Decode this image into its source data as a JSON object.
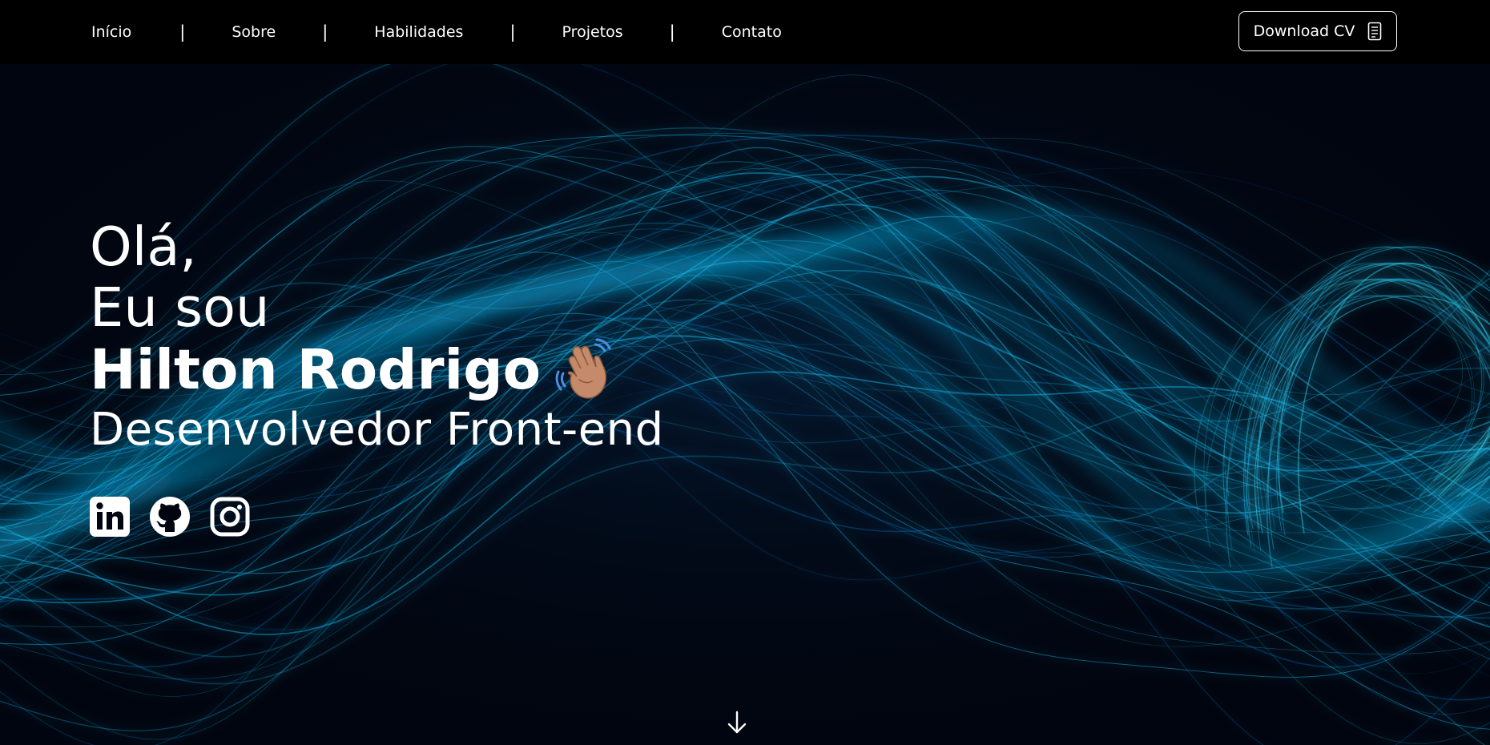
{
  "nav": {
    "items": [
      {
        "label": "Início"
      },
      {
        "label": "Sobre"
      },
      {
        "label": "Habilidades"
      },
      {
        "label": "Projetos"
      },
      {
        "label": "Contato"
      }
    ],
    "separator": "|",
    "cv_button": {
      "label": "Download CV",
      "icon": "document-icon"
    }
  },
  "hero": {
    "greeting": "Olá,",
    "intro": "Eu sou",
    "name": "Hilton Rodrigo",
    "name_emoji": "waving-hand-icon",
    "role": "Desenvolvedor Front-end"
  },
  "socials": [
    {
      "name": "linkedin-icon"
    },
    {
      "name": "github-icon"
    },
    {
      "name": "instagram-icon"
    }
  ],
  "scroll_icon": "arrow-down-icon",
  "colors": {
    "topbar": "#000000",
    "background": "#01050f",
    "wave_primary": "#1ab8e8",
    "wave_secondary": "#0a6fb5",
    "text": "#ffffff"
  }
}
